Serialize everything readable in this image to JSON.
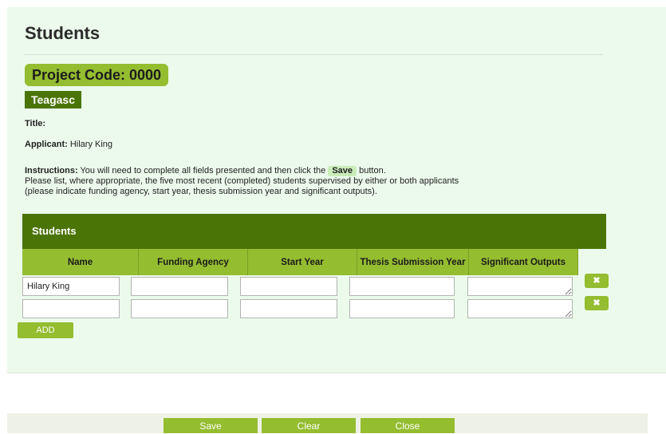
{
  "page": {
    "title": "Students",
    "project_code": "Project Code: 0000",
    "organisation": "Teagasc"
  },
  "meta": {
    "title_label": "Title:",
    "title_value": "",
    "applicant_label": "Applicant:",
    "applicant_value": "Hilary King"
  },
  "instructions": {
    "label": "Instructions:",
    "text_before": "You will need to complete all fields presented and then click the",
    "save_word": "Save",
    "text_after": "button.",
    "line2": "Please list, where appropriate, the five most recent (completed) students supervised by either or both applicants",
    "line3": "(please indicate funding agency, start year, thesis submission year and significant outputs)."
  },
  "table": {
    "section_title": "Students",
    "columns": [
      "Name",
      "Funding Agency",
      "Start Year",
      "Thesis Submission Year",
      "Significant Outputs"
    ],
    "rows": [
      {
        "name": "Hilary King",
        "funding_agency": "",
        "start_year": "",
        "thesis_year": "",
        "outputs": "",
        "delete_label": "✖"
      },
      {
        "name": "",
        "funding_agency": "",
        "start_year": "",
        "thesis_year": "",
        "outputs": "",
        "delete_label": "✖"
      }
    ],
    "add_label": "ADD"
  },
  "footer": {
    "save_label": "Save",
    "clear_label": "Clear",
    "close_label": "Close"
  },
  "colors": {
    "panel_bg": "#ebfaeb",
    "accent_light": "#94bd30",
    "accent_dark": "#4b7407"
  }
}
